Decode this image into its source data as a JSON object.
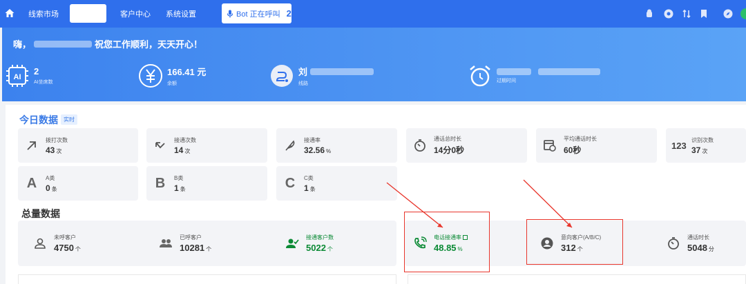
{
  "nav": {
    "items": [
      "线索市场",
      "客户中心",
      "系统设置"
    ],
    "bot_label": "Bot 正在呼叫",
    "bot_count": "2"
  },
  "banner": {
    "greet_prefix": "嗨，",
    "greet_suffix": "祝您工作顺利，天天开心！",
    "stats": [
      {
        "value": "2",
        "label": "AI坐席数"
      },
      {
        "value": "166.41 元",
        "label": "余额"
      },
      {
        "value": "刘",
        "label": "线路"
      },
      {
        "value": "",
        "label": "过期时间"
      }
    ]
  },
  "today": {
    "title": "今日数据",
    "tag": "实时",
    "cards": [
      {
        "label": "拨打次数",
        "value": "43",
        "unit": "次",
        "icon": "call-out-icon"
      },
      {
        "label": "接通次数",
        "value": "14",
        "unit": "次",
        "icon": "call-in-icon"
      },
      {
        "label": "接通率",
        "value": "32.56",
        "unit": "%",
        "icon": "feather-icon"
      },
      {
        "label": "通话总时长",
        "value": "14分0秒",
        "unit": "",
        "icon": "timer-icon"
      },
      {
        "label": "平均通话时长",
        "value": "60秒",
        "unit": "",
        "icon": "calendar-clock-icon"
      },
      {
        "label": "识别次数",
        "value": "37",
        "unit": "次",
        "icon": "number-icon"
      },
      {
        "label": "A类",
        "value": "0",
        "unit": "条",
        "letter": "A"
      },
      {
        "label": "B类",
        "value": "1",
        "unit": "条",
        "letter": "B"
      },
      {
        "label": "C类",
        "value": "1",
        "unit": "条",
        "letter": "C"
      }
    ],
    "n123": "123"
  },
  "total": {
    "title": "总量数据",
    "cards": [
      {
        "label": "未呼客户",
        "value": "4750",
        "unit": "个",
        "icon": "user-outline-icon"
      },
      {
        "label": "已呼客户",
        "value": "10281",
        "unit": "个",
        "icon": "users-icon"
      },
      {
        "label": "接通客户数",
        "value": "5022",
        "unit": "个",
        "icon": "user-check-icon"
      },
      {
        "label": "电话接通率",
        "value": "48.85",
        "unit": "%",
        "icon": "phone-ring-icon"
      },
      {
        "label": "意向客户(A/B/C)",
        "value": "312",
        "unit": "个",
        "icon": "account-circle-icon"
      },
      {
        "label": "通话时长",
        "value": "5048",
        "unit": "分",
        "icon": "timer-icon"
      }
    ]
  },
  "colors": {
    "nav": "#2f6fec",
    "accent": "#3b7be6",
    "green": "#0b8a35",
    "red": "#e8352b"
  }
}
